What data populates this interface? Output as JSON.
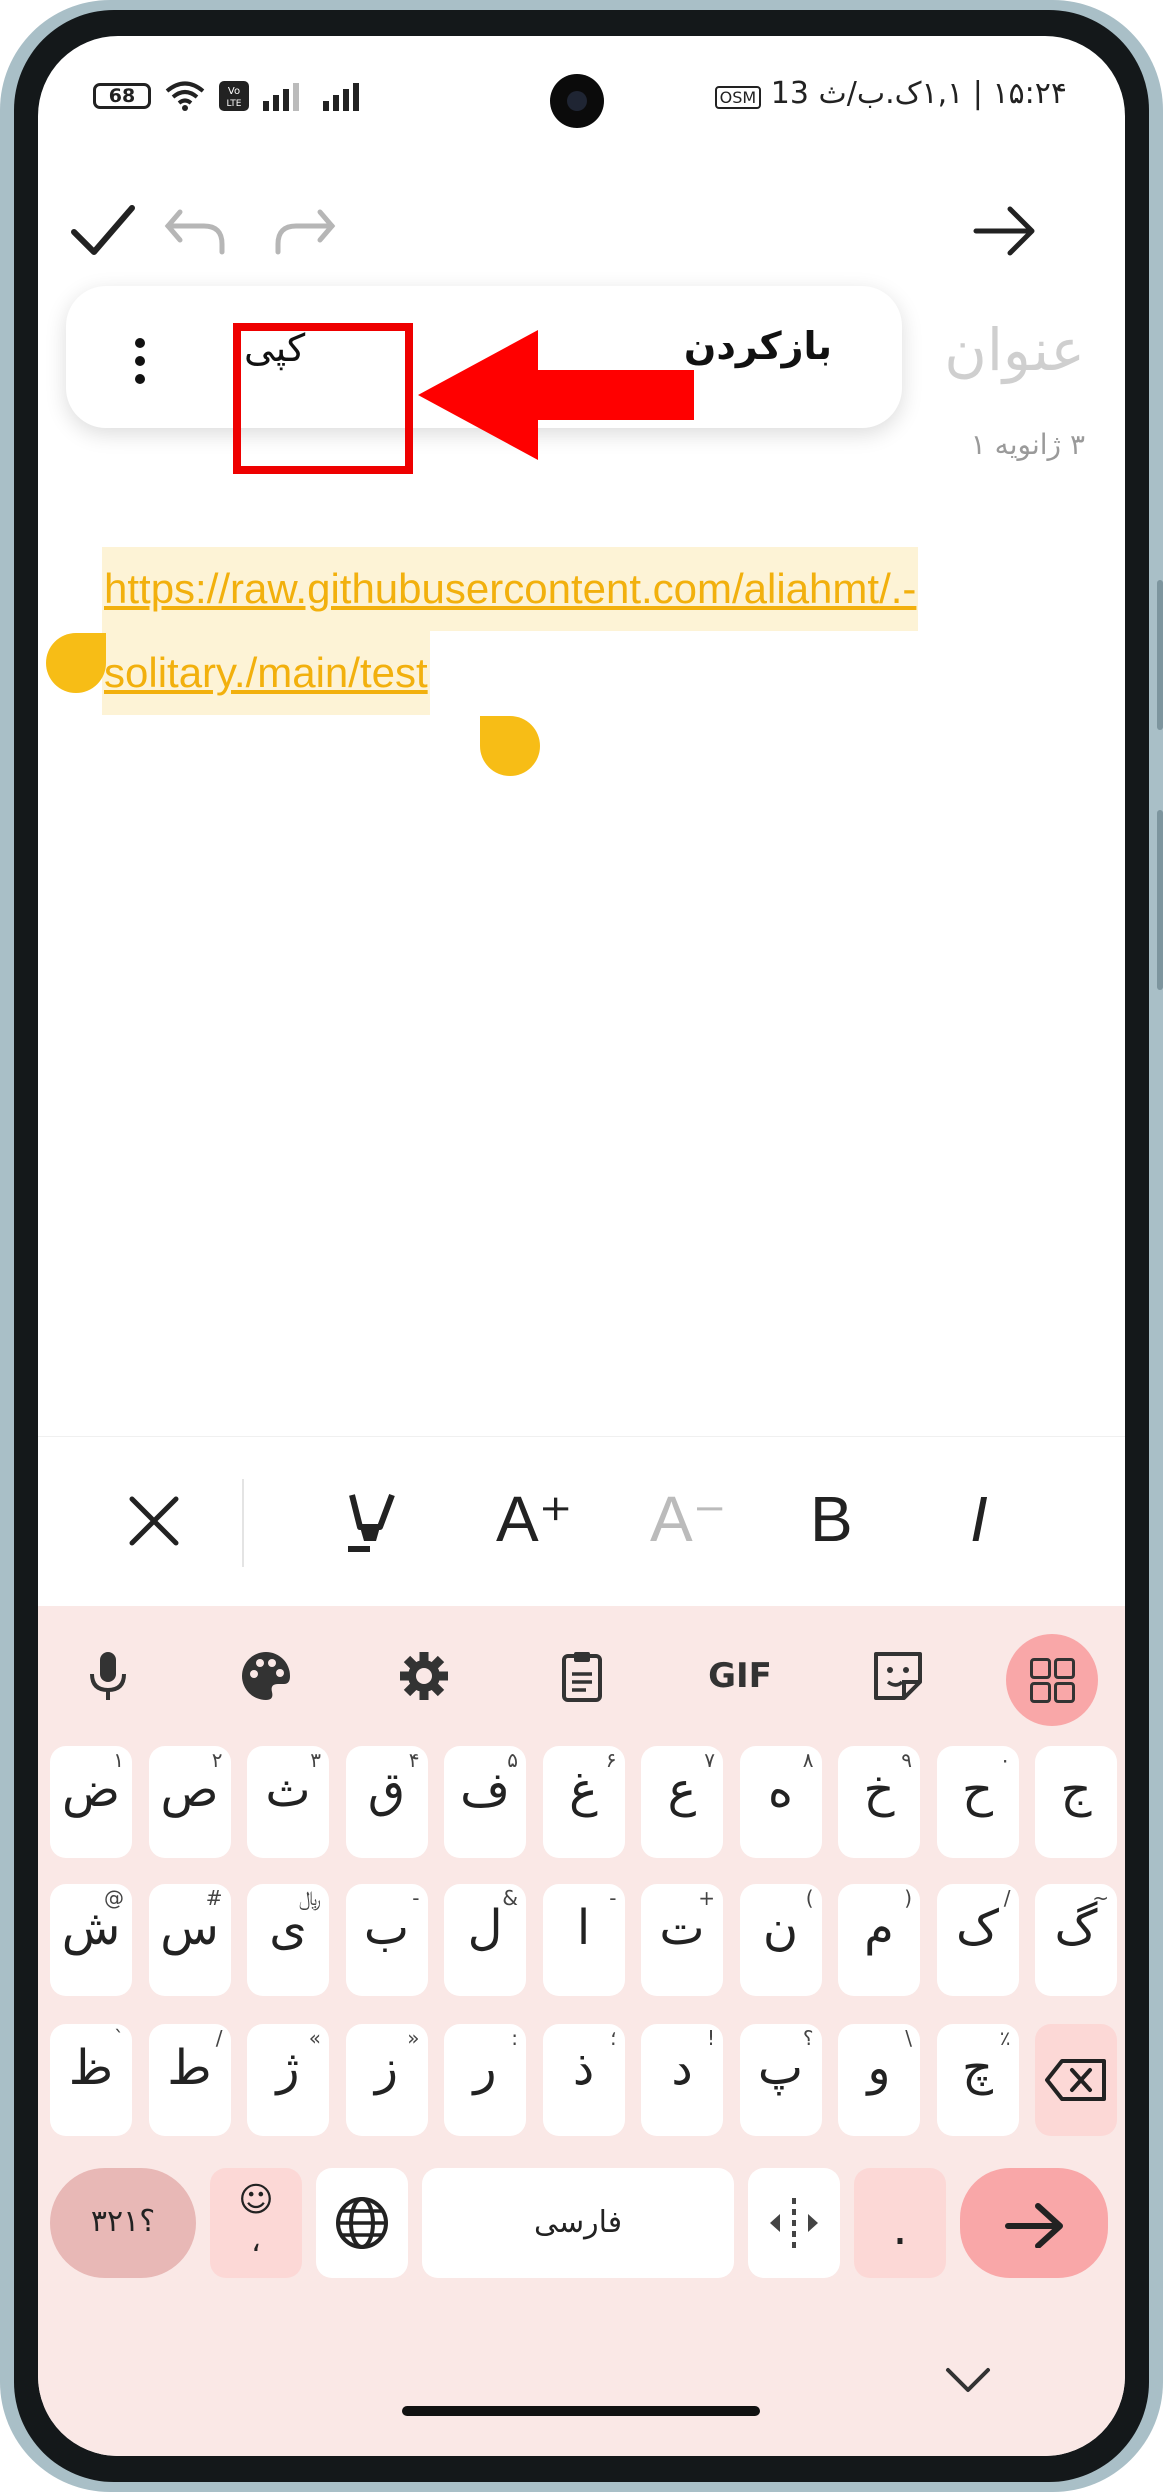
{
  "status_bar": {
    "time": "۱۵:۲۴",
    "date": "۱,۱ک.ب/ث",
    "battery": "68",
    "notif_count": "13",
    "osm": "OSM"
  },
  "toolbar": {
    "confirm_icon": "check-icon",
    "undo_icon": "undo-icon",
    "redo_icon": "redo-icon",
    "back_icon": "arrow-right-icon"
  },
  "note": {
    "title_placeholder": "عنوان",
    "date": "۳ ژانویه ۱"
  },
  "context_menu": {
    "copy": "کپی",
    "undo": "بازکردن",
    "more_icon": "more-vertical-icon"
  },
  "link": {
    "line1": "https://raw.githubusercontent.com/aliahmt/.-",
    "line2": "solitary./main/test"
  },
  "format_bar": {
    "close": "✕",
    "font_increase": "A⁺",
    "font_decrease": "A⁻",
    "bold": "B",
    "italic": "I"
  },
  "keyboard": {
    "tools": [
      "mic-icon",
      "palette-icon",
      "settings-icon",
      "clipboard-icon",
      "GIF",
      "sticker-icon",
      "grid-icon"
    ],
    "row1": [
      {
        "m": "ض",
        "h": "۱"
      },
      {
        "m": "ص",
        "h": "۲"
      },
      {
        "m": "ث",
        "h": "۳"
      },
      {
        "m": "ق",
        "h": "۴"
      },
      {
        "m": "ف",
        "h": "۵"
      },
      {
        "m": "غ",
        "h": "۶"
      },
      {
        "m": "ع",
        "h": "۷"
      },
      {
        "m": "ه",
        "h": "۸"
      },
      {
        "m": "خ",
        "h": "۹"
      },
      {
        "m": "ح",
        "h": "۰"
      },
      {
        "m": "ج",
        "h": ""
      }
    ],
    "row2": [
      {
        "m": "ش",
        "h": "@"
      },
      {
        "m": "س",
        "h": "#"
      },
      {
        "m": "ی",
        "h": "﷼"
      },
      {
        "m": "ب",
        "h": "-"
      },
      {
        "m": "ل",
        "h": "&"
      },
      {
        "m": "ا",
        "h": "-"
      },
      {
        "m": "ت",
        "h": "+"
      },
      {
        "m": "ن",
        "h": "("
      },
      {
        "m": "م",
        "h": ")"
      },
      {
        "m": "ک",
        "h": "/"
      },
      {
        "m": "گ",
        "h": "~"
      }
    ],
    "row3": [
      {
        "m": "ظ",
        "h": "`"
      },
      {
        "m": "ط",
        "h": "/"
      },
      {
        "m": "ژ",
        "h": "«"
      },
      {
        "m": "ز",
        "h": "»"
      },
      {
        "m": "ر",
        "h": ":"
      },
      {
        "m": "ذ",
        "h": "؛"
      },
      {
        "m": "د",
        "h": "!"
      },
      {
        "m": "پ",
        "h": "؟"
      },
      {
        "m": "و",
        "h": "\\"
      },
      {
        "m": "چ",
        "h": "٪"
      }
    ],
    "numbers_key": "؟۳۲۱",
    "emoji_key": "☺",
    "comma": "،",
    "space": "فارسی",
    "period": ".",
    "enter_icon": "enter-icon",
    "hide_icon": "chevron-down-icon"
  }
}
